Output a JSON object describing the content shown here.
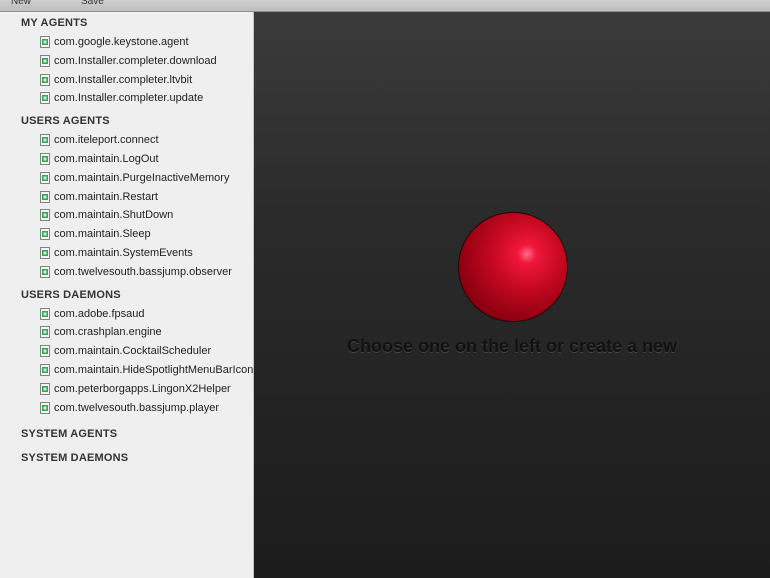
{
  "toolbar": {
    "new_label": "New",
    "save_label": "Save"
  },
  "sidebar": {
    "sections": [
      {
        "title": "MY AGENTS",
        "items": [
          "com.google.keystone.agent",
          "com.Installer.completer.download",
          "com.Installer.completer.ltvbit",
          "com.Installer.completer.update"
        ]
      },
      {
        "title": "USERS AGENTS",
        "items": [
          "com.iteleport.connect",
          "com.maintain.LogOut",
          "com.maintain.PurgeInactiveMemory",
          "com.maintain.Restart",
          "com.maintain.ShutDown",
          "com.maintain.Sleep",
          "com.maintain.SystemEvents",
          "com.twelvesouth.bassjump.observer"
        ]
      },
      {
        "title": "USERS DAEMONS",
        "items": [
          "com.adobe.fpsaud",
          "com.crashplan.engine",
          "com.maintain.CocktailScheduler",
          "com.maintain.HideSpotlightMenuBarIcon",
          "com.peterborgapps.LingonX2Helper",
          "com.twelvesouth.bassjump.player"
        ]
      },
      {
        "title": "SYSTEM AGENTS",
        "items": []
      },
      {
        "title": "SYSTEM DAEMONS",
        "items": []
      }
    ]
  },
  "main": {
    "message": "Choose one on the left or create a new",
    "ball_icon": "red-sphere-icon",
    "ball_color": "#c2081f",
    "background": "#2b2b2b"
  }
}
